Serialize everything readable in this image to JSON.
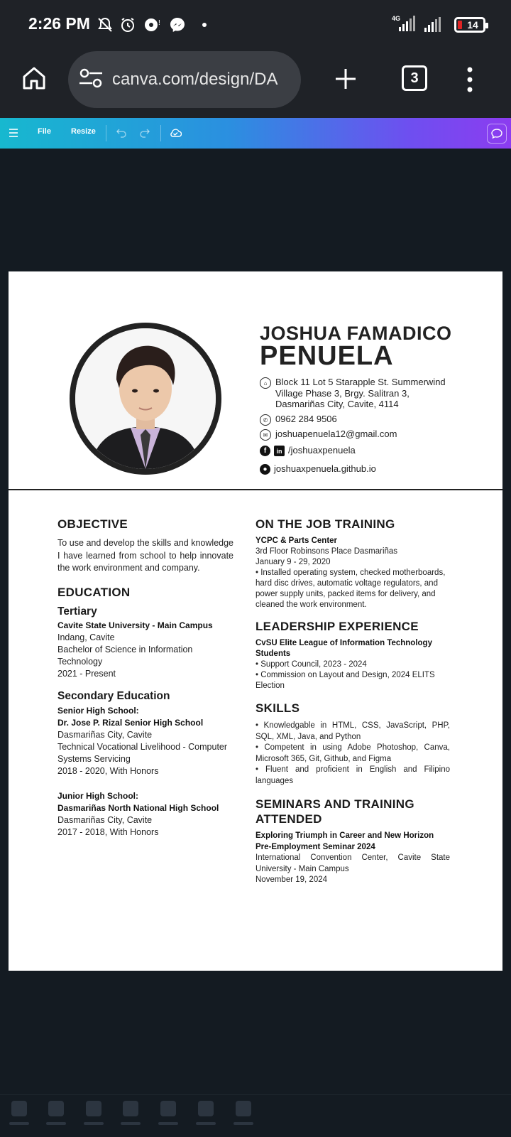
{
  "status_bar": {
    "time": "2:26 PM",
    "network": "4G",
    "battery": "14"
  },
  "browser": {
    "url": "canva.com/design/DA",
    "tab_count": "3"
  },
  "toolbar": {
    "file": "File",
    "resize": "Resize"
  },
  "resume": {
    "name_line1": "JOSHUA FAMADICO",
    "name_line2": "PENUELA",
    "address": "Block 11 Lot 5 Starapple St. Summerwind Village Phase 3, Brgy. Salitran 3, Dasmariñas City, Cavite, 4114",
    "phone": "0962 284 9506",
    "email": "joshuapenuela12@gmail.com",
    "social": "/joshuaxpenuela",
    "website": "joshuaxpenuela.github.io",
    "objective": {
      "heading": "OBJECTIVE",
      "text": "To use and develop the skills and knowledge I have learned from school to help innovate the work environment and company."
    },
    "education": {
      "heading": "EDUCATION",
      "tertiary": {
        "heading": "Tertiary",
        "school": "Cavite State University - Main Campus",
        "location": "Indang, Cavite",
        "degree": "Bachelor of Science in Information Technology",
        "years": "2021 - Present"
      },
      "secondary": {
        "heading": "Secondary Education",
        "senior_label": "Senior High School:",
        "senior_school": "Dr. Jose P. Rizal Senior High School",
        "senior_location": "Dasmariñas City, Cavite",
        "senior_track": "Technical Vocational Livelihood - Computer Systems Servicing",
        "senior_years": "2018 - 2020, With Honors",
        "junior_label": "Junior High School:",
        "junior_school": "Dasmariñas North National High School",
        "junior_location": "Dasmariñas City, Cavite",
        "junior_years": "2017 - 2018, With Honors"
      }
    },
    "ojt": {
      "heading": "ON THE JOB TRAINING",
      "company": "YCPC & Parts Center",
      "address": "3rd Floor Robinsons Place Dasmariñas",
      "dates": "January 9 - 29, 2020",
      "desc": "• Installed operating system, checked motherboards, hard disc drives, automatic voltage regulators, and power supply units, packed items for delivery, and cleaned the work environment."
    },
    "leadership": {
      "heading": "LEADERSHIP EXPERIENCE",
      "org": "CvSU Elite League of Information Technology Students",
      "item1": "• Support Council, 2023 - 2024",
      "item2": "• Commission on Layout and Design, 2024 ELITS Election"
    },
    "skills": {
      "heading": "SKILLS",
      "item1": "• Knowledgable in HTML, CSS, JavaScript, PHP, SQL, XML, Java, and Python",
      "item2": "• Competent in using Adobe Photoshop, Canva, Microsoft 365, Git, Github, and Figma",
      "item3": "• Fluent and proficient in English and Filipino languages"
    },
    "seminars": {
      "heading": "SEMINARS AND TRAINING ATTENDED",
      "title": "Exploring Triumph in Career and New Horizon Pre-Employment Seminar 2024",
      "venue": "International Convention Center, Cavite State University - Main Campus",
      "date": "November 19, 2024"
    }
  }
}
